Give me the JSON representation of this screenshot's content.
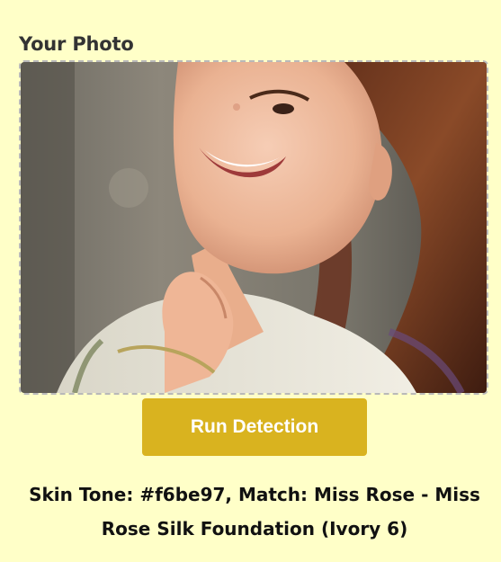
{
  "upload": {
    "label": "Your Photo"
  },
  "actions": {
    "run_label": "Run Detection"
  },
  "result": {
    "text": "Skin Tone: #f6be97, Match: Miss Rose - Miss Rose Silk Foundation (Ivory 6)"
  },
  "colors": {
    "page_background": "#ffffc8",
    "button": "#d9b31f",
    "detected_skin_tone": "#f6be97"
  }
}
